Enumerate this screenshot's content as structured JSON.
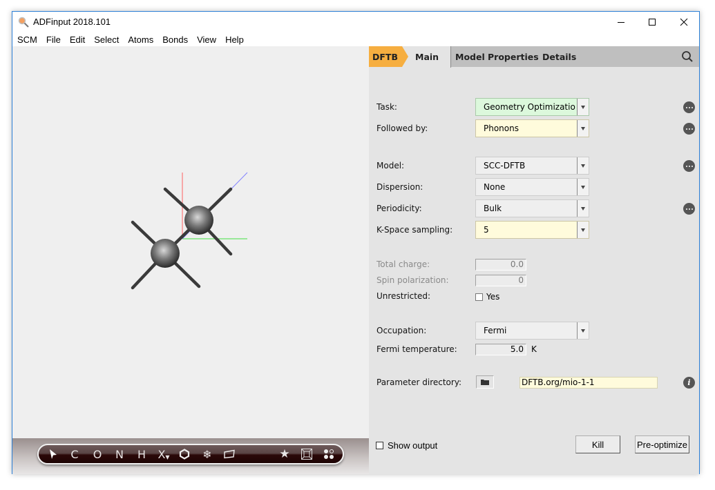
{
  "window": {
    "title": "ADFinput 2018.101",
    "controls": {
      "minimize": "minimize-icon",
      "maximize": "maximize-icon",
      "close": "close-icon"
    }
  },
  "menubar": {
    "items": [
      "SCM",
      "File",
      "Edit",
      "Select",
      "Atoms",
      "Bonds",
      "View",
      "Help"
    ]
  },
  "viewport": {
    "molecule_icon": "ethane-molecule",
    "toolbar": {
      "items": [
        {
          "name": "select-tool",
          "label": "pointer"
        },
        {
          "name": "carbon-tool",
          "label": "C"
        },
        {
          "name": "oxygen-tool",
          "label": "O"
        },
        {
          "name": "nitrogen-tool",
          "label": "N"
        },
        {
          "name": "hydrogen-tool",
          "label": "H"
        },
        {
          "name": "other-element-tool",
          "label": "X"
        },
        {
          "name": "ring-tool",
          "label": "hexagon"
        },
        {
          "name": "freeze-tool",
          "label": "snowflake"
        },
        {
          "name": "plane-tool",
          "label": "parallelogram"
        },
        {
          "name": "favorites-tool",
          "label": "star"
        },
        {
          "name": "crystal-tool",
          "label": "box"
        },
        {
          "name": "structure-tool",
          "label": "dots"
        }
      ]
    }
  },
  "panel": {
    "tabs": [
      {
        "label": "DFTB",
        "active": false,
        "accent": true
      },
      {
        "label": "Main",
        "active": true
      },
      {
        "label": "Model"
      },
      {
        "label": "Properties"
      },
      {
        "label": "Details"
      }
    ],
    "search_icon": "search-icon",
    "fields": {
      "task": {
        "label": "Task:",
        "value": "Geometry Optimizatio"
      },
      "followed_by": {
        "label": "Followed by:",
        "value": "Phonons"
      },
      "model": {
        "label": "Model:",
        "value": "SCC-DFTB"
      },
      "dispersion": {
        "label": "Dispersion:",
        "value": "None"
      },
      "periodicity": {
        "label": "Periodicity:",
        "value": "Bulk"
      },
      "kspace": {
        "label": "K-Space sampling:",
        "value": "5"
      },
      "total_charge": {
        "label": "Total charge:",
        "value": "0.0"
      },
      "spin_polarization": {
        "label": "Spin polarization:",
        "value": "0"
      },
      "unrestricted": {
        "label": "Unrestricted:",
        "checkbox_label": "Yes",
        "checked": false
      },
      "occupation": {
        "label": "Occupation:",
        "value": "Fermi"
      },
      "fermi_temperature": {
        "label": "Fermi temperature:",
        "value": "5.0",
        "unit": "K"
      },
      "parameter_directory": {
        "label": "Parameter directory:",
        "value": "DFTB.org/mio-1-1"
      }
    },
    "footer": {
      "show_output_label": "Show output",
      "show_output_checked": false,
      "kill_label": "Kill",
      "preoptimize_label": "Pre-optimize"
    }
  },
  "colors": {
    "accent_tab": "#f6ae40",
    "task_green": "#dcf8dc",
    "highlight_yellow": "#fffbdc",
    "window_border": "#2b7fd6"
  }
}
